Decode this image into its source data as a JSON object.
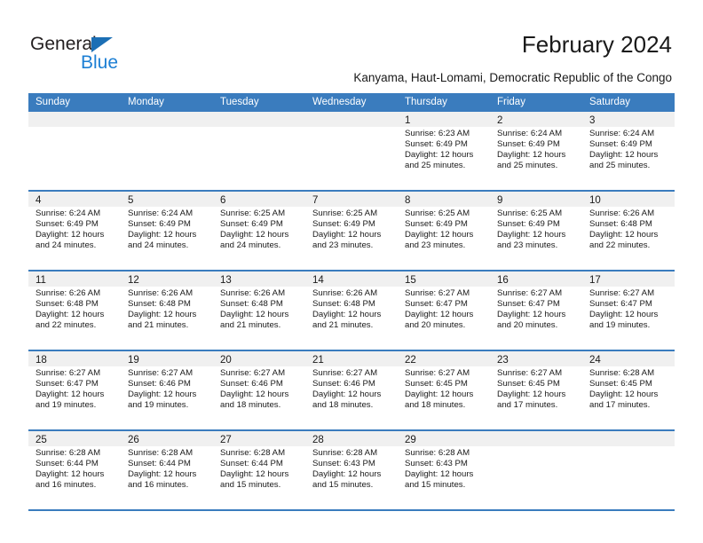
{
  "brand": {
    "name_part1": "General",
    "name_part2": "Blue",
    "triangle_color": "#1c6fb5",
    "blue_color": "#1c7fd4"
  },
  "header": {
    "title": "February 2024",
    "subtitle": "Kanyama, Haut-Lomami, Democratic Republic of the Congo"
  },
  "theme": {
    "header_blue": "#3a7cbe",
    "day_band_gray": "#f0f0f0",
    "text_color": "#1a1a1a"
  },
  "weekdays": [
    "Sunday",
    "Monday",
    "Tuesday",
    "Wednesday",
    "Thursday",
    "Friday",
    "Saturday"
  ],
  "weeks": [
    [
      {
        "day": "",
        "sunrise": "",
        "sunset": "",
        "daylight_line1": "",
        "daylight_line2": "",
        "empty": true
      },
      {
        "day": "",
        "sunrise": "",
        "sunset": "",
        "daylight_line1": "",
        "daylight_line2": "",
        "empty": true
      },
      {
        "day": "",
        "sunrise": "",
        "sunset": "",
        "daylight_line1": "",
        "daylight_line2": "",
        "empty": true
      },
      {
        "day": "",
        "sunrise": "",
        "sunset": "",
        "daylight_line1": "",
        "daylight_line2": "",
        "empty": true
      },
      {
        "day": "1",
        "sunrise": "Sunrise: 6:23 AM",
        "sunset": "Sunset: 6:49 PM",
        "daylight_line1": "Daylight: 12 hours",
        "daylight_line2": "and 25 minutes."
      },
      {
        "day": "2",
        "sunrise": "Sunrise: 6:24 AM",
        "sunset": "Sunset: 6:49 PM",
        "daylight_line1": "Daylight: 12 hours",
        "daylight_line2": "and 25 minutes."
      },
      {
        "day": "3",
        "sunrise": "Sunrise: 6:24 AM",
        "sunset": "Sunset: 6:49 PM",
        "daylight_line1": "Daylight: 12 hours",
        "daylight_line2": "and 25 minutes."
      }
    ],
    [
      {
        "day": "4",
        "sunrise": "Sunrise: 6:24 AM",
        "sunset": "Sunset: 6:49 PM",
        "daylight_line1": "Daylight: 12 hours",
        "daylight_line2": "and 24 minutes."
      },
      {
        "day": "5",
        "sunrise": "Sunrise: 6:24 AM",
        "sunset": "Sunset: 6:49 PM",
        "daylight_line1": "Daylight: 12 hours",
        "daylight_line2": "and 24 minutes."
      },
      {
        "day": "6",
        "sunrise": "Sunrise: 6:25 AM",
        "sunset": "Sunset: 6:49 PM",
        "daylight_line1": "Daylight: 12 hours",
        "daylight_line2": "and 24 minutes."
      },
      {
        "day": "7",
        "sunrise": "Sunrise: 6:25 AM",
        "sunset": "Sunset: 6:49 PM",
        "daylight_line1": "Daylight: 12 hours",
        "daylight_line2": "and 23 minutes."
      },
      {
        "day": "8",
        "sunrise": "Sunrise: 6:25 AM",
        "sunset": "Sunset: 6:49 PM",
        "daylight_line1": "Daylight: 12 hours",
        "daylight_line2": "and 23 minutes."
      },
      {
        "day": "9",
        "sunrise": "Sunrise: 6:25 AM",
        "sunset": "Sunset: 6:49 PM",
        "daylight_line1": "Daylight: 12 hours",
        "daylight_line2": "and 23 minutes."
      },
      {
        "day": "10",
        "sunrise": "Sunrise: 6:26 AM",
        "sunset": "Sunset: 6:48 PM",
        "daylight_line1": "Daylight: 12 hours",
        "daylight_line2": "and 22 minutes."
      }
    ],
    [
      {
        "day": "11",
        "sunrise": "Sunrise: 6:26 AM",
        "sunset": "Sunset: 6:48 PM",
        "daylight_line1": "Daylight: 12 hours",
        "daylight_line2": "and 22 minutes."
      },
      {
        "day": "12",
        "sunrise": "Sunrise: 6:26 AM",
        "sunset": "Sunset: 6:48 PM",
        "daylight_line1": "Daylight: 12 hours",
        "daylight_line2": "and 21 minutes."
      },
      {
        "day": "13",
        "sunrise": "Sunrise: 6:26 AM",
        "sunset": "Sunset: 6:48 PM",
        "daylight_line1": "Daylight: 12 hours",
        "daylight_line2": "and 21 minutes."
      },
      {
        "day": "14",
        "sunrise": "Sunrise: 6:26 AM",
        "sunset": "Sunset: 6:48 PM",
        "daylight_line1": "Daylight: 12 hours",
        "daylight_line2": "and 21 minutes."
      },
      {
        "day": "15",
        "sunrise": "Sunrise: 6:27 AM",
        "sunset": "Sunset: 6:47 PM",
        "daylight_line1": "Daylight: 12 hours",
        "daylight_line2": "and 20 minutes."
      },
      {
        "day": "16",
        "sunrise": "Sunrise: 6:27 AM",
        "sunset": "Sunset: 6:47 PM",
        "daylight_line1": "Daylight: 12 hours",
        "daylight_line2": "and 20 minutes."
      },
      {
        "day": "17",
        "sunrise": "Sunrise: 6:27 AM",
        "sunset": "Sunset: 6:47 PM",
        "daylight_line1": "Daylight: 12 hours",
        "daylight_line2": "and 19 minutes."
      }
    ],
    [
      {
        "day": "18",
        "sunrise": "Sunrise: 6:27 AM",
        "sunset": "Sunset: 6:47 PM",
        "daylight_line1": "Daylight: 12 hours",
        "daylight_line2": "and 19 minutes."
      },
      {
        "day": "19",
        "sunrise": "Sunrise: 6:27 AM",
        "sunset": "Sunset: 6:46 PM",
        "daylight_line1": "Daylight: 12 hours",
        "daylight_line2": "and 19 minutes."
      },
      {
        "day": "20",
        "sunrise": "Sunrise: 6:27 AM",
        "sunset": "Sunset: 6:46 PM",
        "daylight_line1": "Daylight: 12 hours",
        "daylight_line2": "and 18 minutes."
      },
      {
        "day": "21",
        "sunrise": "Sunrise: 6:27 AM",
        "sunset": "Sunset: 6:46 PM",
        "daylight_line1": "Daylight: 12 hours",
        "daylight_line2": "and 18 minutes."
      },
      {
        "day": "22",
        "sunrise": "Sunrise: 6:27 AM",
        "sunset": "Sunset: 6:45 PM",
        "daylight_line1": "Daylight: 12 hours",
        "daylight_line2": "and 18 minutes."
      },
      {
        "day": "23",
        "sunrise": "Sunrise: 6:27 AM",
        "sunset": "Sunset: 6:45 PM",
        "daylight_line1": "Daylight: 12 hours",
        "daylight_line2": "and 17 minutes."
      },
      {
        "day": "24",
        "sunrise": "Sunrise: 6:28 AM",
        "sunset": "Sunset: 6:45 PM",
        "daylight_line1": "Daylight: 12 hours",
        "daylight_line2": "and 17 minutes."
      }
    ],
    [
      {
        "day": "25",
        "sunrise": "Sunrise: 6:28 AM",
        "sunset": "Sunset: 6:44 PM",
        "daylight_line1": "Daylight: 12 hours",
        "daylight_line2": "and 16 minutes."
      },
      {
        "day": "26",
        "sunrise": "Sunrise: 6:28 AM",
        "sunset": "Sunset: 6:44 PM",
        "daylight_line1": "Daylight: 12 hours",
        "daylight_line2": "and 16 minutes."
      },
      {
        "day": "27",
        "sunrise": "Sunrise: 6:28 AM",
        "sunset": "Sunset: 6:44 PM",
        "daylight_line1": "Daylight: 12 hours",
        "daylight_line2": "and 15 minutes."
      },
      {
        "day": "28",
        "sunrise": "Sunrise: 6:28 AM",
        "sunset": "Sunset: 6:43 PM",
        "daylight_line1": "Daylight: 12 hours",
        "daylight_line2": "and 15 minutes."
      },
      {
        "day": "29",
        "sunrise": "Sunrise: 6:28 AM",
        "sunset": "Sunset: 6:43 PM",
        "daylight_line1": "Daylight: 12 hours",
        "daylight_line2": "and 15 minutes."
      },
      {
        "day": "",
        "sunrise": "",
        "sunset": "",
        "daylight_line1": "",
        "daylight_line2": "",
        "empty": true
      },
      {
        "day": "",
        "sunrise": "",
        "sunset": "",
        "daylight_line1": "",
        "daylight_line2": "",
        "empty": true
      }
    ]
  ]
}
